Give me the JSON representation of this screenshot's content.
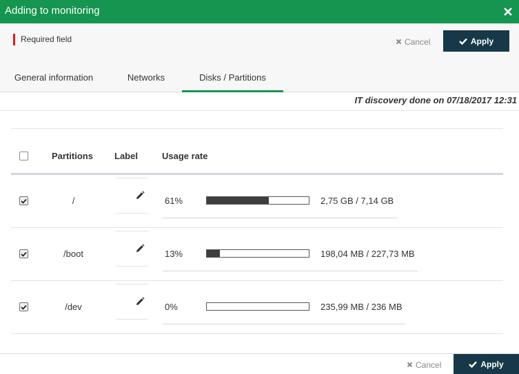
{
  "dialog": {
    "title": "Adding to monitoring",
    "close_icon": "close-icon"
  },
  "header": {
    "required_label": "Required field",
    "required_color": "#d31f1f",
    "cancel_label": "Cancel",
    "apply_label": "Apply"
  },
  "tabs": [
    {
      "label": "General information",
      "active": false
    },
    {
      "label": "Networks",
      "active": false
    },
    {
      "label": "Disks / Partitions",
      "active": true
    }
  ],
  "discovery_text": "IT discovery done on 07/18/2017 12:31",
  "table": {
    "columns": [
      "Partitions",
      "Label",
      "Usage rate"
    ],
    "select_all_checked": false,
    "rows": [
      {
        "checked": true,
        "partition": "/",
        "label": "",
        "usage_pct": "61%",
        "usage_fraction": 0.61,
        "size": "2,75 GB / 7,14 GB"
      },
      {
        "checked": true,
        "partition": "/boot",
        "label": "",
        "usage_pct": "13%",
        "usage_fraction": 0.13,
        "size": "198,04 MB / 227,73 MB"
      },
      {
        "checked": true,
        "partition": "/dev",
        "label": "",
        "usage_pct": "0%",
        "usage_fraction": 0.0,
        "size": "235,99 MB / 236 MB"
      }
    ]
  },
  "footer": {
    "cancel_label": "Cancel",
    "apply_label": "Apply"
  },
  "colors": {
    "brand_green": "#15954f",
    "apply_button": "#163848",
    "usage_bar_fill": "#3e3e3e"
  }
}
